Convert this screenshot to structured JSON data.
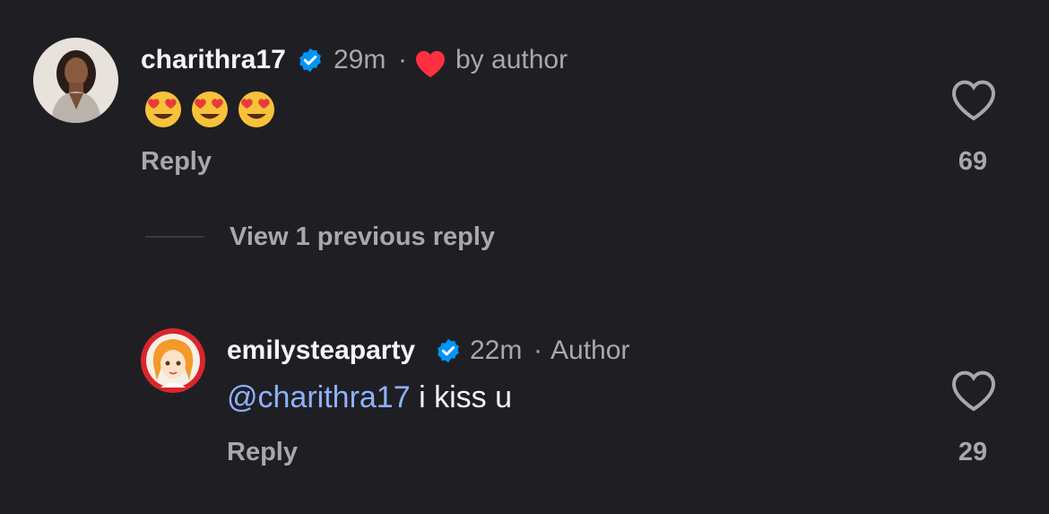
{
  "comments": [
    {
      "username": "charithra17",
      "verified": true,
      "time": "29m",
      "separator": "·",
      "liked_by_author_text": "by author",
      "body_emojis": [
        "heart-eyes-emoji",
        "heart-eyes-emoji",
        "heart-eyes-emoji"
      ],
      "reply_label": "Reply",
      "like_count": "69"
    },
    {
      "username": "emilysteaparty",
      "verified": true,
      "time": "22m",
      "separator": "·",
      "author_badge": "Author",
      "mention": "@charithra17",
      "body_text": " i kiss u",
      "reply_label": "Reply",
      "like_count": "29"
    }
  ],
  "view_previous_replies": "View 1 previous reply",
  "colors": {
    "background": "#1f1f23",
    "verified_blue": "#0095f6",
    "heart_red": "#ff3040",
    "mention_blue": "#8fb1ff",
    "secondary_text": "#a8a8a8"
  }
}
